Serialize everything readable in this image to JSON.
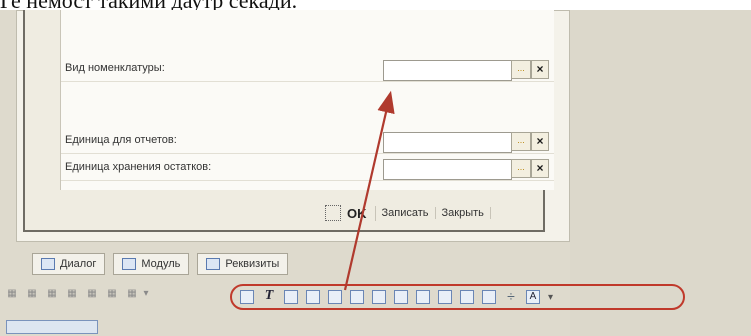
{
  "header": {
    "text": "Ге немост такими даутр секади."
  },
  "form": {
    "fields": [
      {
        "label": "Вид номенклатуры:",
        "dots": "...",
        "clear": "×"
      },
      {
        "label": "Единица для отчетов:",
        "dots": "...",
        "clear": "×"
      },
      {
        "label": "Единица хранения остатков:",
        "dots": "...",
        "clear": "×"
      }
    ],
    "buttons": {
      "ok": "OK",
      "save": "Записать",
      "close": "Закрыть"
    }
  },
  "tabs": [
    {
      "label": "Диалог"
    },
    {
      "label": "Модуль"
    },
    {
      "label": "Реквизиты"
    }
  ],
  "toolbar": {
    "text_tool_glyph": "T",
    "cross_tool_glyph": "÷",
    "font_tool_glyph": "A"
  },
  "colors": {
    "highlight": "#c0392b",
    "arrow": "#b03a2e"
  }
}
